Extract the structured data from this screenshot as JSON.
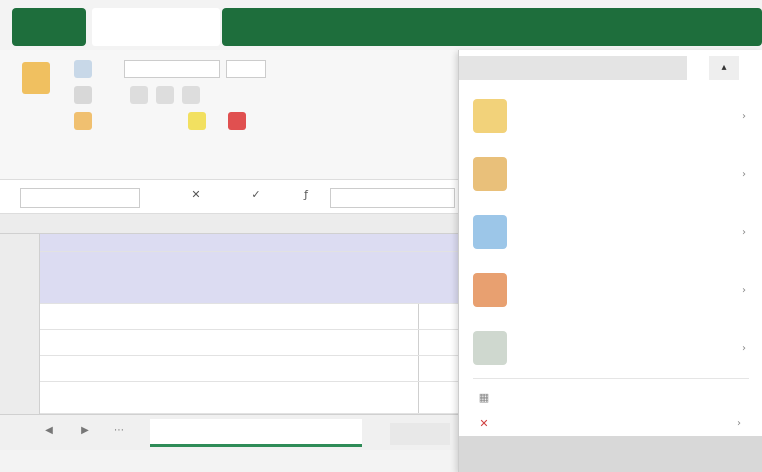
{
  "tabs": {
    "file": "",
    "active": "",
    "others": [
      "",
      "",
      "",
      "",
      "",
      "",
      ""
    ]
  },
  "ribbon": {
    "font_name": "",
    "font_size": "",
    "number_format": "",
    "alignment": "",
    "styles": ""
  },
  "formula_bar": {
    "name_box": "",
    "formula": ""
  },
  "grid": {
    "column_b": "",
    "rows": [
      {
        "num": "",
        "text": ""
      },
      {
        "num": "",
        "text": ""
      },
      {
        "num": "",
        "text": ""
      },
      {
        "num": "",
        "text": ""
      },
      {
        "num": "",
        "text": ""
      },
      {
        "num": "",
        "text": ""
      }
    ]
  },
  "sheets": {
    "active": "",
    "add": ""
  },
  "status": "",
  "dropdown": {
    "header": "",
    "items": [
      {
        "label": "",
        "icon": "conditional-format-icon",
        "color": "#f2d27a"
      },
      {
        "label": "",
        "icon": "format-table-icon",
        "color": "#e9c07a"
      },
      {
        "label": "",
        "icon": "cell-styles-icon",
        "color": "#9cc6e8"
      },
      {
        "label": "",
        "icon": "color-scales-icon",
        "color": "#e8a070"
      },
      {
        "label": "",
        "icon": "icon-sets-icon",
        "color": "#cfd8cf"
      }
    ],
    "small_items": [
      {
        "label": ""
      },
      {
        "label": ""
      }
    ],
    "footer": ""
  }
}
